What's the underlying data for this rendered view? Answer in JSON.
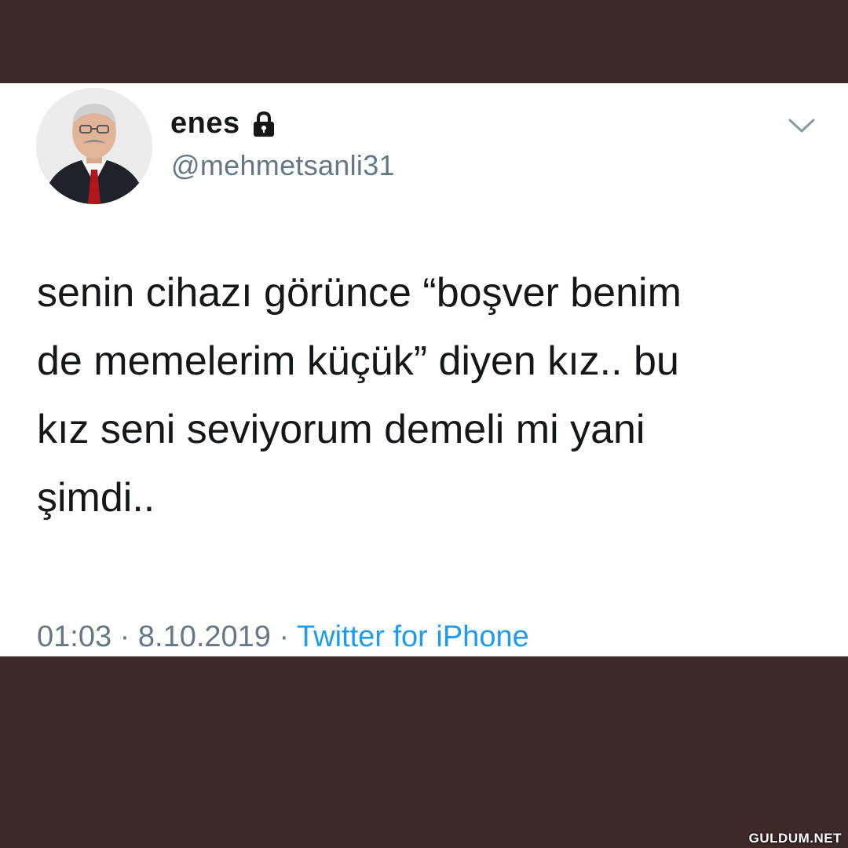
{
  "tweet": {
    "display_name": "enes",
    "handle": "@mehmetsanli31",
    "text": "senin cihazı görünce “boşver benim\nde memelerim küçük” diyen kız.. bu\nkız seni seviyorum demeli mi yani\nşimdi..",
    "time": "01:03",
    "separator": "·",
    "date": "8.10.2019",
    "source": "Twitter for iPhone",
    "locked_icon": "lock-icon",
    "menu_icon": "chevron-down-icon"
  },
  "watermark": "GULDUM.NET",
  "colors": {
    "frame": "#3f2a2a",
    "card": "#ffffff",
    "text": "#14171a",
    "muted": "#657786",
    "link": "#1d9bf0"
  }
}
